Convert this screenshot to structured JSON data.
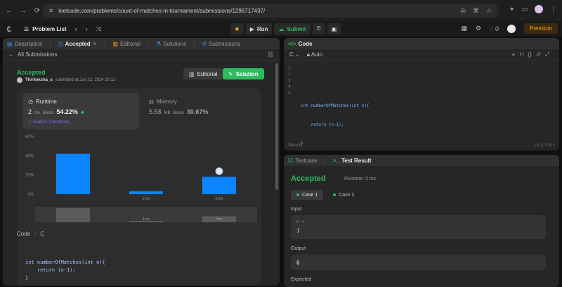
{
  "browser": {
    "url": "leetcode.com/problems/count-of-matches-in-tournament/submissions/1296717437/"
  },
  "topbar": {
    "problem_list": "Problem List",
    "run": "Run",
    "submit": "Submit",
    "coins": "0",
    "premium": "Premium"
  },
  "left_tabs": {
    "description": "Description",
    "accepted": "Accepted",
    "editorial": "Editorial",
    "solutions": "Solutions",
    "submissions": "Submissions"
  },
  "all_submissions": "All Submissions",
  "submission": {
    "status": "Accepted",
    "user": "Thiriloksha_s",
    "submitted_text": "submitted at Jun 22, 2024 20:11",
    "editorial_btn": "Editorial",
    "solution_btn": "Solution"
  },
  "runtime": {
    "title": "Runtime",
    "value": "2",
    "unit": "ms",
    "beats_label": "Beats",
    "beats": "54.22%",
    "analyze": "Analyze Complexity"
  },
  "memory": {
    "title": "Memory",
    "value": "5.58",
    "unit": "MB",
    "beats_label": "Beats",
    "beats": "30.67%"
  },
  "chart_data": {
    "type": "bar",
    "categories": [
      "",
      "1ms",
      "2ms"
    ],
    "values": [
      42,
      3,
      18
    ],
    "highlight_index": 2,
    "ylim": [
      0,
      60
    ],
    "yticks": [
      "60%",
      "40%",
      "20%",
      "0%"
    ],
    "yticks_values": [
      60,
      40,
      20,
      0
    ],
    "mini_labels": [
      "",
      "1ms",
      "2ms"
    ],
    "bar_color": "#0a84ff",
    "grid": true
  },
  "code_section": {
    "label": "Code",
    "lang": "C",
    "lines": [
      "int numberOfMatches(int n){",
      "    return (n-1);",
      "}"
    ]
  },
  "editor": {
    "tab": "Code",
    "lang": "C",
    "mode": "Auto",
    "line_numbers": [
      "1",
      "2",
      "3",
      "4",
      "5"
    ],
    "lines": [
      "",
      "",
      "int numberOfMatches(int n){",
      "    return (n-1);",
      "}"
    ],
    "saved": "Saved",
    "position": "Ln 1, Col 1"
  },
  "result_tabs": {
    "testcase": "Testcase",
    "test_result": "Test Result"
  },
  "result": {
    "status": "Accepted",
    "runtime": "Runtime: 2 ms",
    "case1": "Case 1",
    "case2": "Case 2",
    "input_label": "Input",
    "input_key": "n =",
    "input_value": "7",
    "output_label": "Output",
    "output_value": "6",
    "expected_label": "Expected"
  }
}
